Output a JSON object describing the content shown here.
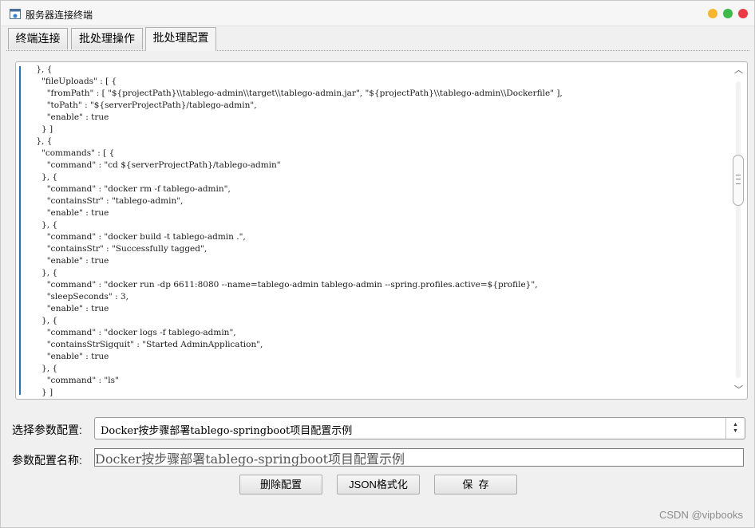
{
  "window": {
    "title": "服务器连接终端",
    "controls": [
      "minimize",
      "maximize",
      "close"
    ]
  },
  "tabs": [
    {
      "label": "终端连接",
      "active": false
    },
    {
      "label": "批处理操作",
      "active": false
    },
    {
      "label": "批处理配置",
      "active": true
    }
  ],
  "editor": {
    "lines": [
      "    }, {",
      "      \"fileUploads\" : [ {",
      "        \"fromPath\" : [ \"${projectPath}\\\\tablego-admin\\\\target\\\\tablego-admin.jar\", \"${projectPath}\\\\tablego-admin\\\\Dockerfile\" ],",
      "        \"toPath\" : \"${serverProjectPath}/tablego-admin\",",
      "        \"enable\" : true",
      "      } ]",
      "    }, {",
      "      \"commands\" : [ {",
      "        \"command\" : \"cd ${serverProjectPath}/tablego-admin\"",
      "      }, {",
      "        \"command\" : \"docker rm -f tablego-admin\",",
      "        \"containsStr\" : \"tablego-admin\",",
      "        \"enable\" : true",
      "      }, {",
      "        \"command\" : \"docker build -t tablego-admin .\",",
      "        \"containsStr\" : \"Successfully tagged\",",
      "        \"enable\" : true",
      "      }, {",
      "        \"command\" : \"docker run -dp 6611:8080 --name=tablego-admin tablego-admin --spring.profiles.active=${profile}\",",
      "        \"sleepSeconds\" : 3,",
      "        \"enable\" : true",
      "      }, {",
      "        \"command\" : \"docker logs -f tablego-admin\",",
      "        \"containsStrSigquit\" : \"Started AdminApplication\",",
      "        \"enable\" : true",
      "      }, {",
      "        \"command\" : \"ls\"",
      "      } ]"
    ]
  },
  "form": {
    "select_label": "选择参数配置:",
    "select_value": "Docker按步骤部署tablego-springboot项目配置示例",
    "name_label": "参数配置名称:",
    "name_value": "Docker按步骤部署tablego-springboot项目配置示例"
  },
  "buttons": {
    "delete": "删除配置",
    "format_json": "JSON格式化",
    "save": "保  存"
  },
  "watermark": "CSDN @vipbooks",
  "colors": {
    "accent_line": "#1c72c6",
    "minimize": "#f8b62d",
    "maximize": "#3cbb47",
    "close": "#ee3a44"
  }
}
